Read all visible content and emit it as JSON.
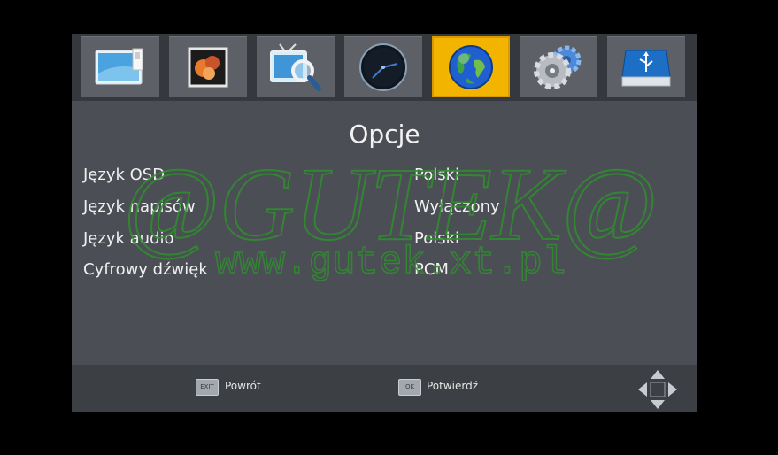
{
  "tabs": [
    {
      "icon": "monitor-icon",
      "active": false
    },
    {
      "icon": "photo-icon",
      "active": false
    },
    {
      "icon": "tv-search-icon",
      "active": false
    },
    {
      "icon": "clock-icon",
      "active": false
    },
    {
      "icon": "globe-icon",
      "active": true
    },
    {
      "icon": "settings-gears-icon",
      "active": false
    },
    {
      "icon": "usb-drive-icon",
      "active": false
    }
  ],
  "title": "Opcje",
  "settings": [
    {
      "label": "Język OSD",
      "value": "Polski"
    },
    {
      "label": "Język napisów",
      "value": "Wyłączony"
    },
    {
      "label": "Język audio",
      "value": "Polski"
    },
    {
      "label": "Cyfrowy dźwięk",
      "value": "PCM"
    }
  ],
  "footer": {
    "back_key": "EXIT",
    "back_label": "Powrót",
    "ok_key": "OK",
    "ok_label": "Potwierdź",
    "nav_icon": "dpad-arrows-icon"
  },
  "watermark": {
    "line1": "@GUTEK@",
    "line2": "www.gutek.xt.pl",
    "color": "#2f8f2f"
  },
  "colors": {
    "active_tab": "#f3b400",
    "panel": "#4b4e54",
    "tab_bar": "#35383d",
    "footer": "#3c3f44"
  }
}
